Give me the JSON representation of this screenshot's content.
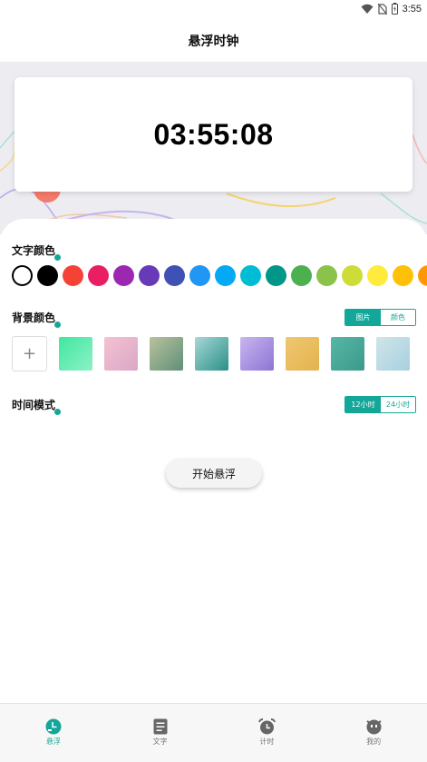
{
  "status_bar": {
    "time": "3:55",
    "icons": [
      "wifi-icon",
      "no-sim-icon",
      "battery-icon"
    ]
  },
  "app_bar": {
    "title": "悬浮时钟"
  },
  "clock": {
    "time": "03:55:08"
  },
  "text_color": {
    "label": "文字颜色",
    "swatches": [
      "#ffffff",
      "#000000",
      "#f44336",
      "#e91e63",
      "#9c27b0",
      "#673ab7",
      "#3f51b5",
      "#2196f3",
      "#03a9f4",
      "#00bcd4",
      "#009688",
      "#4caf50",
      "#8bc34a",
      "#cddc39",
      "#ffeb3b",
      "#ffc107",
      "#ff9800"
    ],
    "selected_index": 0
  },
  "background": {
    "label": "背景颜色",
    "mode_options": [
      "图片",
      "颜色"
    ],
    "mode_selected": "图片",
    "add_label": "+",
    "tiles": [
      [
        "#3ee8a0",
        "#8ff0c6"
      ],
      [
        "#f5c2d2",
        "#d9a7c6"
      ],
      [
        "#b9c29d",
        "#5f8f78"
      ],
      [
        "#a8d8d6",
        "#2a8f88"
      ],
      [
        "#c9b6f0",
        "#8c74d3"
      ],
      [
        "#f0c870",
        "#e3b24f"
      ],
      [
        "#57b7a6",
        "#3b9a8b"
      ],
      [
        "#cfe6e8",
        "#a8cfe0"
      ]
    ]
  },
  "time_mode": {
    "label": "时间模式",
    "options": [
      "12小时",
      "24小时"
    ],
    "selected": "12小时"
  },
  "start_button": {
    "label": "开始悬浮"
  },
  "bottom_nav": {
    "items": [
      {
        "label": "悬浮",
        "icon": "floating-clock-icon",
        "active": true
      },
      {
        "label": "文字",
        "icon": "document-icon",
        "active": false
      },
      {
        "label": "计时",
        "icon": "alarm-clock-icon",
        "active": false
      },
      {
        "label": "我的",
        "icon": "profile-face-icon",
        "active": false
      }
    ]
  },
  "colors": {
    "accent": "#13a79a",
    "hero_bg": "#ececf1"
  }
}
